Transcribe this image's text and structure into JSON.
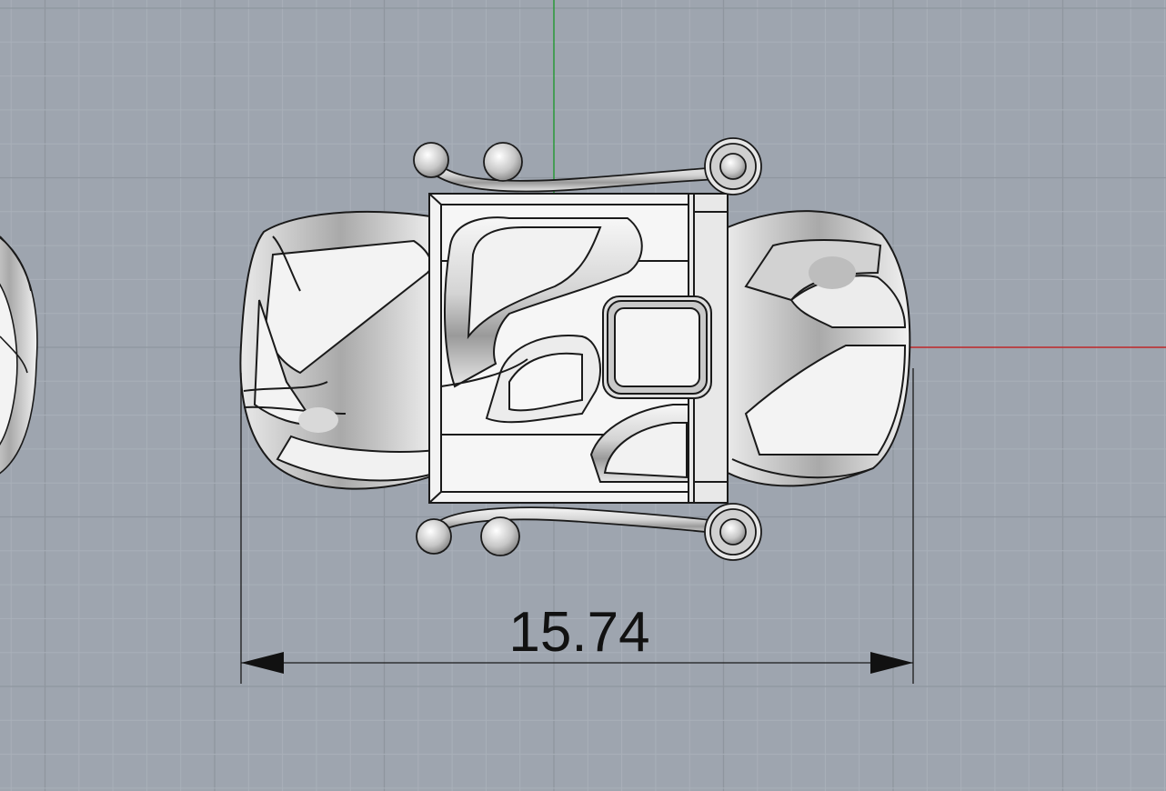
{
  "viewport": {
    "view": "Top",
    "background": "#9ea5af",
    "grid_minor_color": "#a9b0b9",
    "grid_major_color": "#8f969f",
    "x_axis_color": "#c0282b",
    "y_axis_color": "#2a9a3a"
  },
  "dimension": {
    "label": "15.74",
    "type": "linear"
  },
  "model": {
    "object": "curb-chain-box-clasp",
    "surface_color": "#f3f3f3",
    "shade_color": "#c9c9c9",
    "edge_color": "#1a1a1a"
  }
}
